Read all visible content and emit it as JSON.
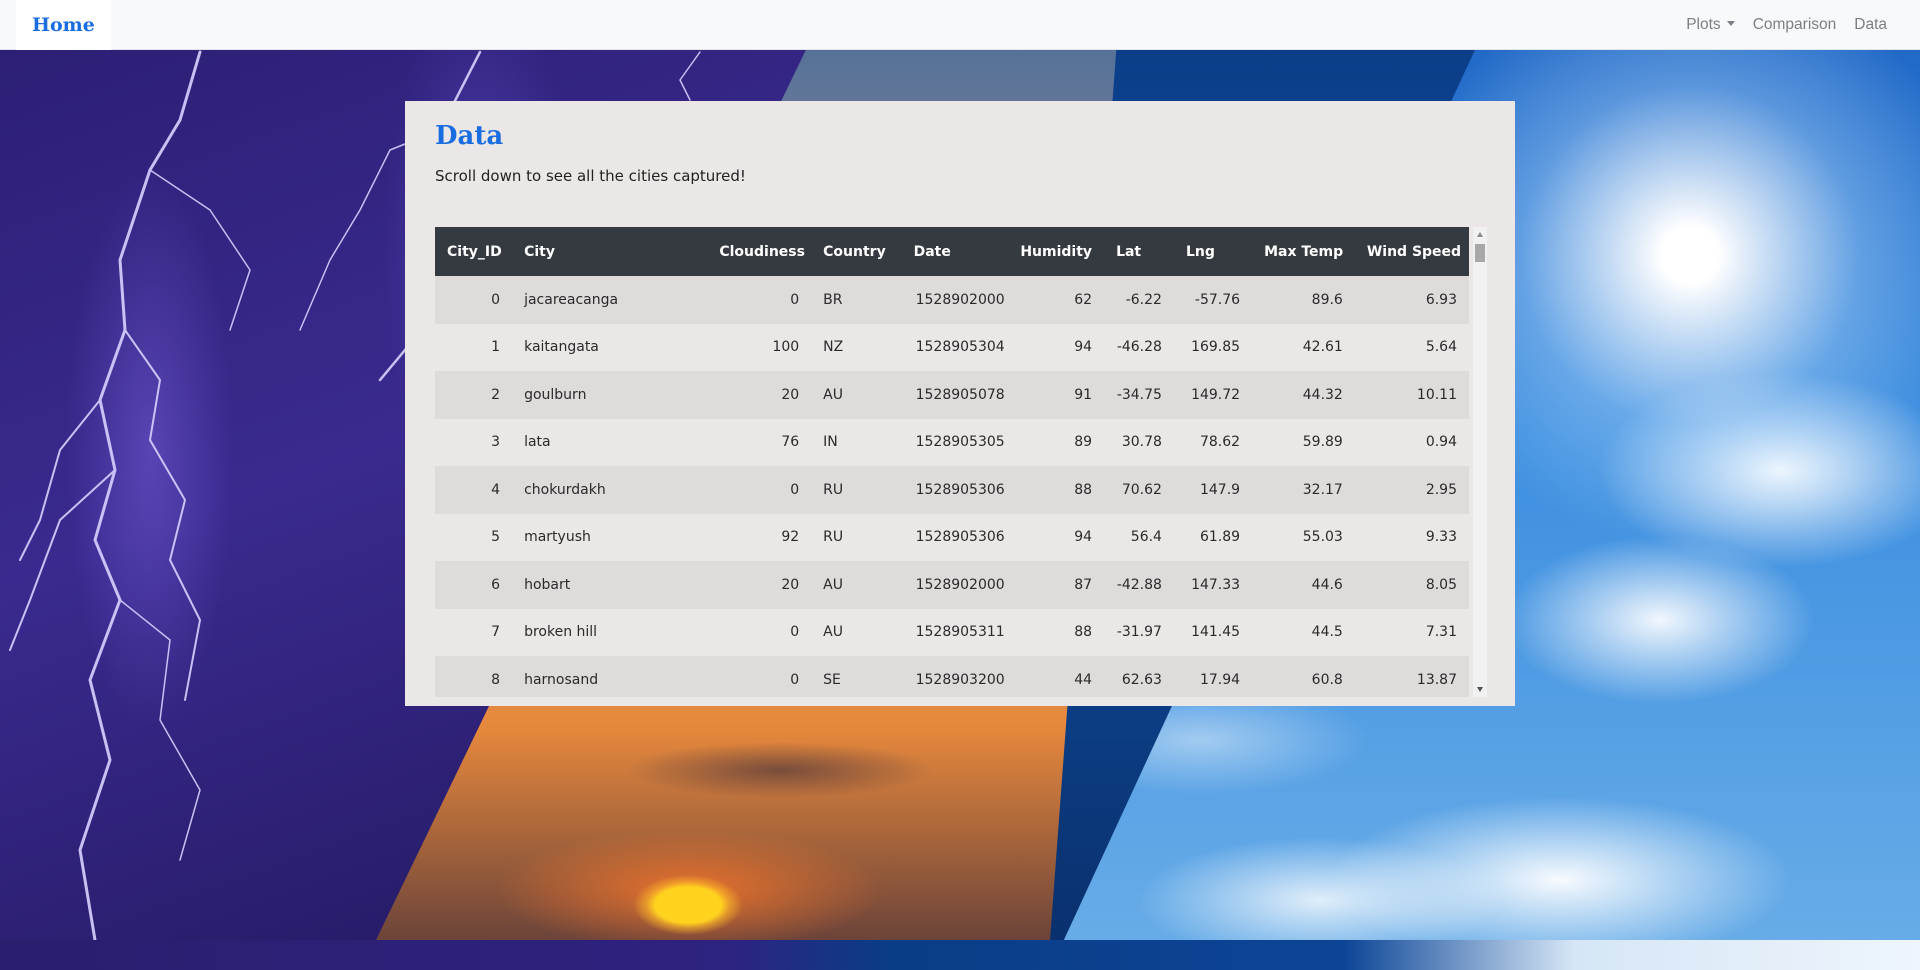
{
  "navbar": {
    "brand": "Home",
    "links": {
      "plots": "Plots",
      "comparison": "Comparison",
      "data": "Data"
    }
  },
  "card": {
    "title": "Data",
    "subtitle": "Scroll down to see all the cities captured!"
  },
  "table": {
    "columns": [
      "City_ID",
      "City",
      "Cloudiness",
      "Country",
      "Date",
      "Humidity",
      "Lat",
      "Lng",
      "Max Temp",
      "Wind Speed"
    ],
    "rows": [
      [
        "0",
        "jacareacanga",
        "0",
        "BR",
        "1528902000",
        "62",
        "-6.22",
        "-57.76",
        "89.6",
        "6.93"
      ],
      [
        "1",
        "kaitangata",
        "100",
        "NZ",
        "1528905304",
        "94",
        "-46.28",
        "169.85",
        "42.61",
        "5.64"
      ],
      [
        "2",
        "goulburn",
        "20",
        "AU",
        "1528905078",
        "91",
        "-34.75",
        "149.72",
        "44.32",
        "10.11"
      ],
      [
        "3",
        "lata",
        "76",
        "IN",
        "1528905305",
        "89",
        "30.78",
        "78.62",
        "59.89",
        "0.94"
      ],
      [
        "4",
        "chokurdakh",
        "0",
        "RU",
        "1528905306",
        "88",
        "70.62",
        "147.9",
        "32.17",
        "2.95"
      ],
      [
        "5",
        "martyush",
        "92",
        "RU",
        "1528905306",
        "94",
        "56.4",
        "61.89",
        "55.03",
        "9.33"
      ],
      [
        "6",
        "hobart",
        "20",
        "AU",
        "1528902000",
        "87",
        "-42.88",
        "147.33",
        "44.6",
        "8.05"
      ],
      [
        "7",
        "broken hill",
        "0",
        "AU",
        "1528905311",
        "88",
        "-31.97",
        "141.45",
        "44.5",
        "7.31"
      ],
      [
        "8",
        "harnosand",
        "0",
        "SE",
        "1528903200",
        "44",
        "62.63",
        "17.94",
        "60.8",
        "13.87"
      ]
    ]
  }
}
